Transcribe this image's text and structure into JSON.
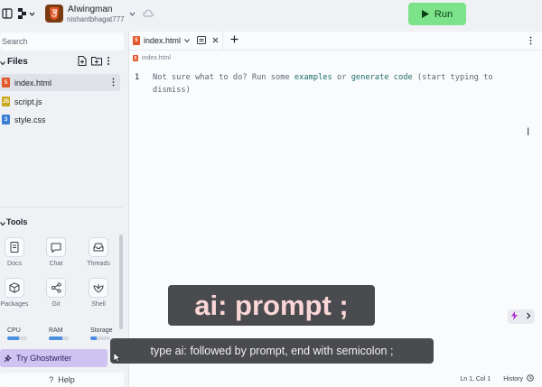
{
  "topbar": {
    "project_name": "AIwingman",
    "owner": "nishantbhagat777",
    "run_label": "Run"
  },
  "sidebar": {
    "search_placeholder": "Search",
    "files_heading": "Files",
    "files": [
      {
        "name": "index.html",
        "type": "html",
        "color": "#e2582b"
      },
      {
        "name": "script.js",
        "type": "js",
        "color": "#c8a81c"
      },
      {
        "name": "style.css",
        "type": "css",
        "color": "#3b7fd6"
      }
    ],
    "tools_heading": "Tools",
    "tools": [
      {
        "label": "Docs",
        "icon": "docs-icon"
      },
      {
        "label": "Chat",
        "icon": "chat-icon"
      },
      {
        "label": "Threads",
        "icon": "threads-icon"
      },
      {
        "label": "Packages",
        "icon": "packages-icon"
      },
      {
        "label": "Git",
        "icon": "git-icon"
      },
      {
        "label": "Shell",
        "icon": "shell-icon"
      }
    ],
    "meters": [
      {
        "label": "CPU",
        "level": 0.6
      },
      {
        "label": "RAM",
        "level": 0.7
      },
      {
        "label": "Storage",
        "level": 0.3
      }
    ],
    "ghostwriter_label": "Try Ghostwriter",
    "help_label": "Help"
  },
  "editor": {
    "tab_label": "index.html",
    "breadcrumb": "index.html",
    "line_number": "1",
    "hint_before": "Not sure what to do? Run some ",
    "hint_link1": "examples",
    "hint_mid": " or ",
    "hint_link2": "generate code",
    "hint_after": " (start typing to dismiss)",
    "position": "Ln 1, Col 1",
    "history_label": "History"
  },
  "overlays": {
    "big_text": "ai: prompt ;",
    "small_text": "type ai: followed by prompt, end with semicolon ;"
  },
  "colors": {
    "run_button": "#7de38a",
    "ghostwriter": "#cfc3f2",
    "link": "#1e6d66",
    "html_icon": "#e2582b"
  }
}
